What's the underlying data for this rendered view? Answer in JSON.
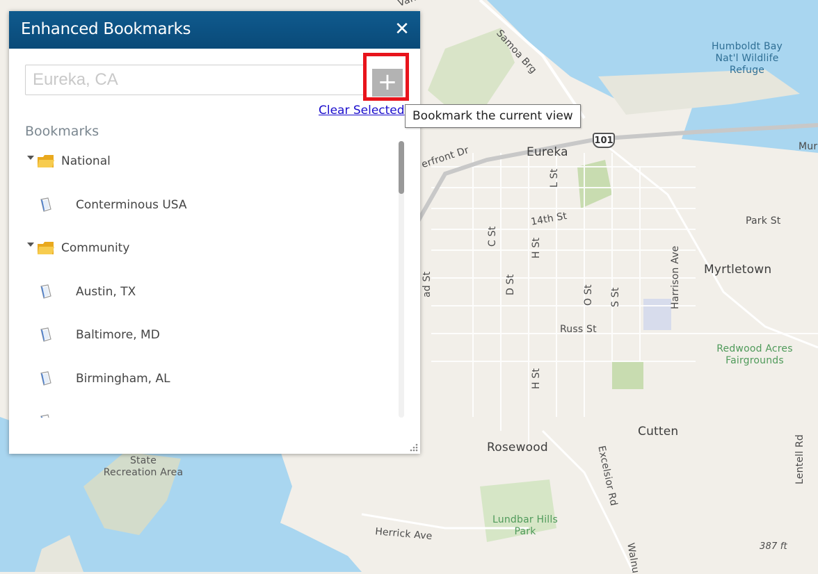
{
  "panel": {
    "title": "Enhanced Bookmarks",
    "close_glyph": "✕",
    "search": {
      "value": "",
      "placeholder": "Eureka, CA"
    },
    "add_button_glyph": "+",
    "clear_link": "Clear Selected",
    "heading": "Bookmarks",
    "folders": [
      {
        "label": "National",
        "expanded": true,
        "icon": "folder-icon",
        "items": [
          {
            "label": "Conterminous USA",
            "icon": "bookmark-icon"
          }
        ]
      },
      {
        "label": "Community",
        "expanded": true,
        "icon": "folder-icon",
        "items": [
          {
            "label": "Austin, TX",
            "icon": "bookmark-icon"
          },
          {
            "label": "Baltimore, MD",
            "icon": "bookmark-icon"
          },
          {
            "label": "Birmingham, AL",
            "icon": "bookmark-icon"
          }
        ]
      }
    ]
  },
  "tooltip": "Bookmark the current view",
  "map": {
    "labels": {
      "eureka": "Eureka",
      "myrtletown": "Myrtletown",
      "cutten": "Cutten",
      "rosewood": "Rosewood",
      "humboldt_1": "Humboldt Bay",
      "humboldt_2": "Nat'l Wildlife",
      "humboldt_3": "Refuge",
      "redwood_1": "Redwood Acres",
      "redwood_2": "Fairgrounds",
      "lundbar_1": "Lundbar Hills",
      "lundbar_2": "Park",
      "state_1": "State",
      "state_2": "Recreation Area",
      "samoa": "Samoa Brg",
      "waterfront": "erfront Dr",
      "st14": "14th St",
      "park_st": "Park St",
      "russ_st": "Russ St",
      "herrick": "Herrick Ave",
      "l_st": "L St",
      "c_st": "C St",
      "h_st": "H St",
      "h_st2": "H St",
      "d_st": "D St",
      "o_st": "O St",
      "s_st": "S St",
      "harrison": "Harrison Ave",
      "excelsior": "Excelsior Rd",
      "lentell": "Lentell Rd",
      "walnut": "Walnu",
      "vance": "Vance",
      "mur": "Mur",
      "elev": "387 ft",
      "hwy": "101",
      "ad_st": "ad St"
    },
    "colors": {
      "water": "#a9d6f0",
      "land": "#f2efe9",
      "park": "#c8dcb0",
      "header": "#0b4f80",
      "highlight": "#e8141c"
    }
  }
}
